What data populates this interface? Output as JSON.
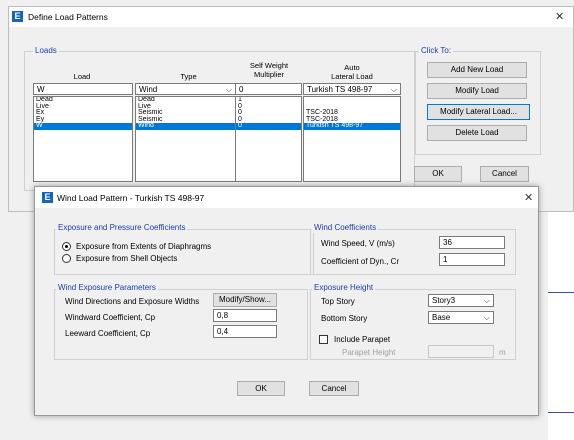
{
  "define_window": {
    "title": "Define Load Patterns",
    "loads_group_label": "Loads",
    "columns": {
      "load": "Load",
      "type": "Type",
      "self_weight": [
        "Self Weight",
        "Multiplier"
      ],
      "auto": [
        "Auto",
        "Lateral Load"
      ]
    },
    "inputs": {
      "load_name": "W",
      "type": "Wind",
      "multiplier": "0",
      "auto_lateral": "Turkish TS 498-97"
    },
    "rows": [
      {
        "load": "Dead",
        "type": "Dead",
        "multiplier": "1",
        "auto": ""
      },
      {
        "load": "Live",
        "type": "Live",
        "multiplier": "0",
        "auto": ""
      },
      {
        "load": "Ex",
        "type": "Seismic",
        "multiplier": "0",
        "auto": "TSC-2018"
      },
      {
        "load": "Ey",
        "type": "Seismic",
        "multiplier": "0",
        "auto": "TSC-2018"
      },
      {
        "load": "W",
        "type": "Wind",
        "multiplier": "0",
        "auto": "Turkish TS 498-97"
      }
    ],
    "selected_row": 4,
    "click_to_label": "Click To:",
    "buttons": {
      "add": "Add New Load",
      "modify": "Modify Load",
      "modify_lateral": "Modify Lateral Load...",
      "delete": "Delete Load",
      "ok": "OK",
      "cancel": "Cancel"
    }
  },
  "wind_window": {
    "title": "Wind Load Pattern - Turkish TS 498-97",
    "exposure_group": {
      "label": "Exposure and Pressure Coefficients",
      "option_diaphragms": "Exposure from Extents of Diaphragms",
      "option_shell": "Exposure from Shell Objects",
      "selected": "diaphragms"
    },
    "wind_coefficients": {
      "label": "Wind Coefficients",
      "wind_speed_label": "Wind Speed, V (m/s)",
      "wind_speed_value": "36",
      "coef_label": "Coefficient of Dyn., Cr",
      "coef_value": "1"
    },
    "wind_exposure_parameters": {
      "label": "Wind Exposure Parameters",
      "directions_label": "Wind Directions and Exposure Widths",
      "modify_show_button": "Modify/Show...",
      "windward_label": "Windward Coefficient, Cp",
      "windward_value": "0,8",
      "leeward_label": "Leeward Coefficient, Cp",
      "leeward_value": "0,4"
    },
    "exposure_height": {
      "label": "Exposure Height",
      "top_story_label": "Top Story",
      "top_story_value": "Story3",
      "bottom_story_label": "Bottom Story",
      "bottom_story_value": "Base",
      "include_parapet_label": "Include Parapet",
      "include_parapet_checked": false,
      "parapet_height_label": "Parapet Height",
      "parapet_height_value": "",
      "parapet_unit": "m"
    },
    "buttons": {
      "ok": "OK",
      "cancel": "Cancel"
    }
  },
  "icons": {
    "app_icon_letter": "E",
    "close_glyph": "✕",
    "chevron_glyph": "⌵"
  },
  "colors": {
    "group_label": "#1a3fa6",
    "selection": "#0078d7",
    "app_icon": "#1565c0"
  }
}
